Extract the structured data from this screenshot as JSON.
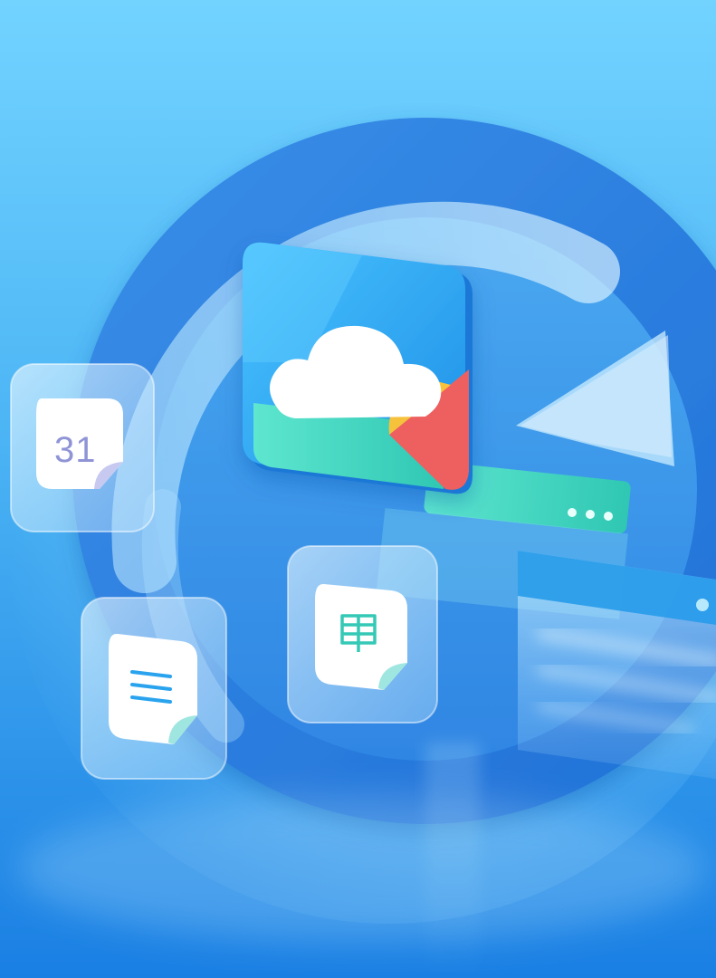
{
  "illustration": {
    "calendar_day": "31",
    "icons": {
      "center_app": "cloud-sync-app-icon",
      "calendar": "calendar-icon",
      "document": "document-icon",
      "spreadsheet": "spreadsheet-icon",
      "sync_arrow": "sync-arrow-icon",
      "window_panel_primary": "browser-window-icon",
      "window_panel_secondary": "browser-window-icon"
    },
    "colors": {
      "sky_top": "#6fd0ff",
      "sky_bottom": "#1d83e6",
      "ring": "#2f7fe0",
      "cloud": "#ffffff",
      "sun": "#f7c23b",
      "red_triangle": "#ee5e5e",
      "teal": "#3fd6c0",
      "accent_blue": "#31a9ee",
      "calendar_text": "#8f94d6"
    }
  }
}
